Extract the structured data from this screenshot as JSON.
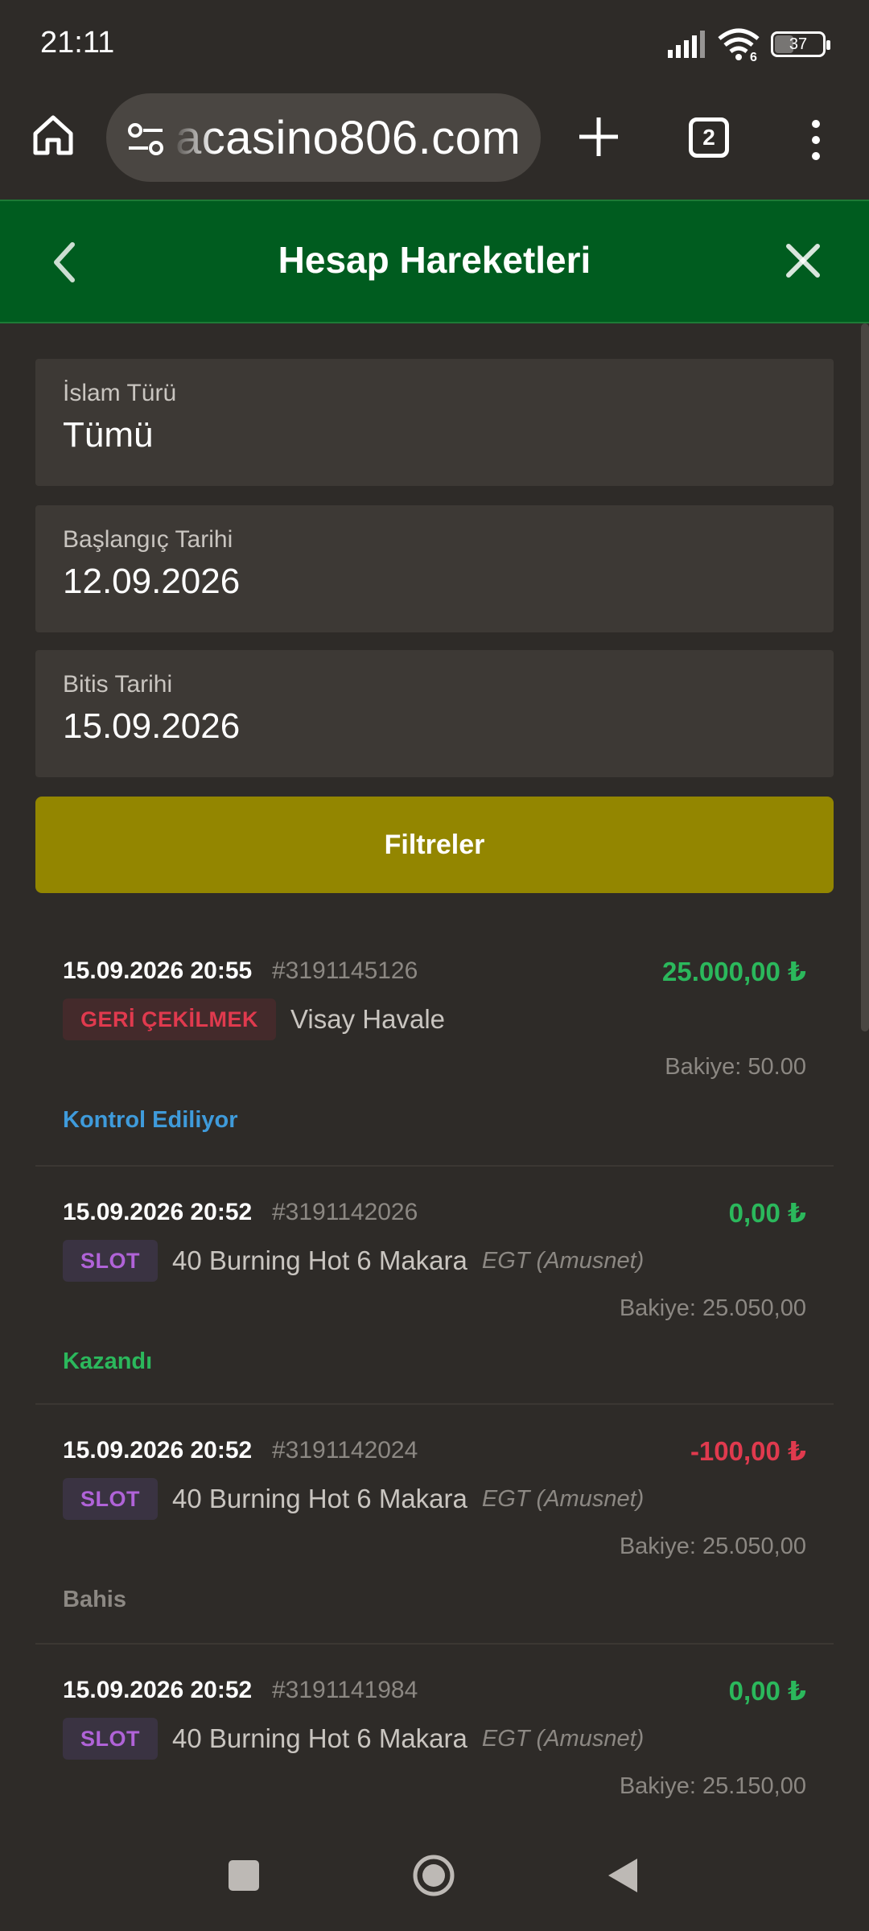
{
  "status_bar": {
    "time": "21:11",
    "battery": "37",
    "wifi_badge": "6"
  },
  "browser": {
    "url": "acasino806.com",
    "tab_count": "2",
    "icons": [
      "home-icon",
      "site-settings-icon",
      "plus-icon",
      "tabs-icon",
      "more-vert-icon"
    ]
  },
  "header": {
    "title": "Hesap Hareketleri",
    "accent_color": "#005c1f"
  },
  "filters": {
    "type_label": "İslam Türü",
    "type_value": "Tümü",
    "start_label": "Başlangıç Tarihi",
    "start_value": "12.09.2026",
    "end_label": "Bitis Tarihi",
    "end_value": "15.09.2026",
    "button_label": "Filtreler",
    "button_color": "#938600"
  },
  "transactions": [
    {
      "date": "15.09.2026 20:55",
      "id": "#3191145126",
      "amount": "25.000,00 ₺",
      "badge": "GERİ ÇEKİLMEK",
      "name": "Visay Havale",
      "provider": "",
      "balance": "Bakiye: 50.00",
      "status": "Kontrol Ediliyor"
    },
    {
      "date": "15.09.2026 20:52",
      "id": "#3191142026",
      "amount": "0,00 ₺",
      "badge": "SLOT",
      "name": "40 Burning Hot 6 Makara",
      "provider": "EGT (Amusnet)",
      "balance": "Bakiye: 25.050,00",
      "status": "Kazandı"
    },
    {
      "date": "15.09.2026 20:52",
      "id": "#3191142024",
      "amount": "-100,00 ₺",
      "badge": "SLOT",
      "name": "40 Burning Hot 6 Makara",
      "provider": "EGT (Amusnet)",
      "balance": "Bakiye: 25.050,00",
      "status": "Bahis"
    },
    {
      "date": "15.09.2026 20:52",
      "id": "#3191141984",
      "amount": "0,00 ₺",
      "badge": "SLOT",
      "name": "40 Burning Hot 6 Makara",
      "provider": "EGT (Amusnet)",
      "balance": "Bakiye: 25.150,00",
      "status": ""
    }
  ],
  "colors": {
    "positive": "#2bb85c",
    "negative": "#e03a4e",
    "status_pending": "#3f9bdb"
  }
}
